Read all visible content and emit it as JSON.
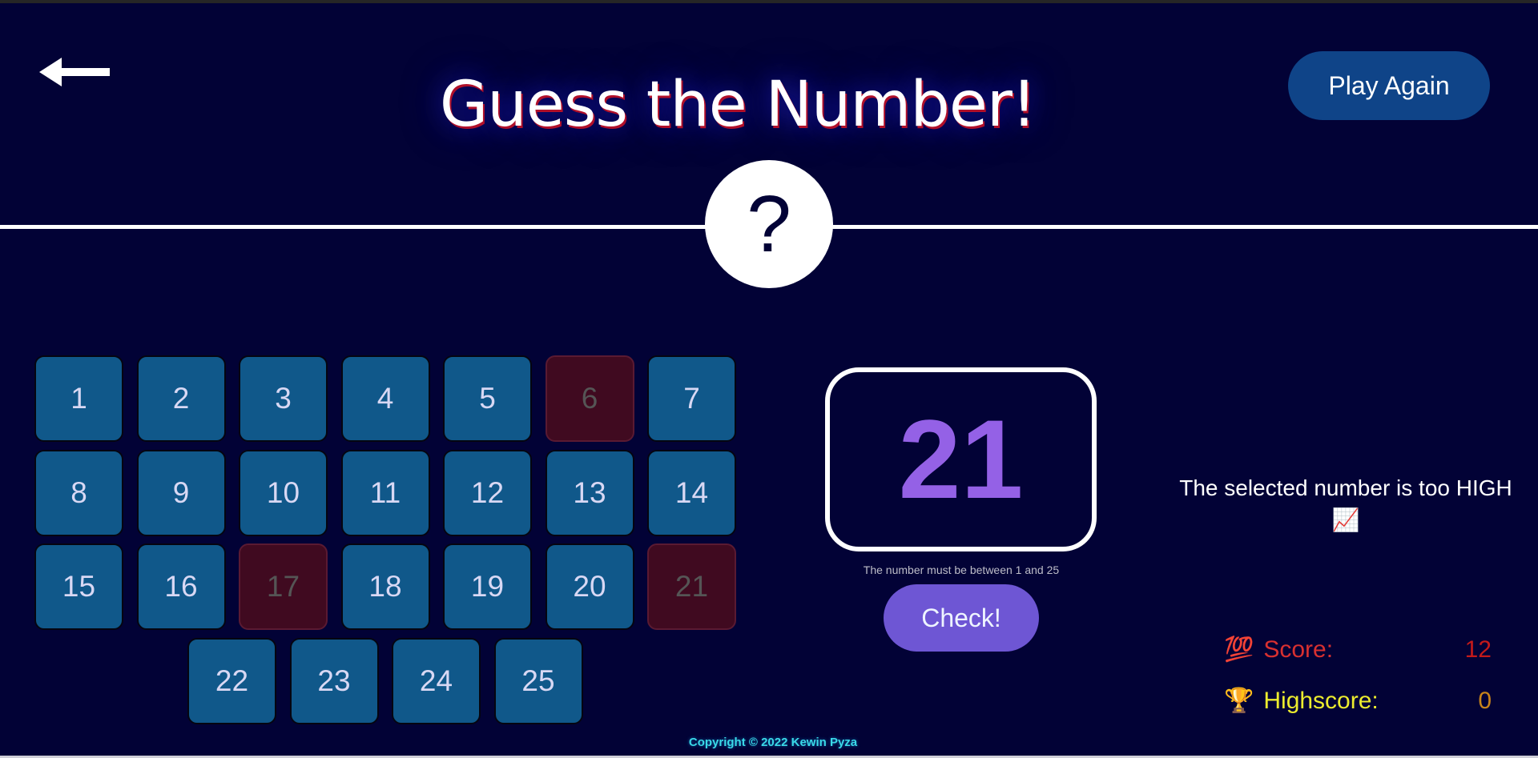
{
  "header": {
    "title": "Guess the Number!",
    "play_again_label": "Play Again",
    "mystery_symbol": "?"
  },
  "board": {
    "tiles": [
      {
        "n": "1",
        "state": "available"
      },
      {
        "n": "2",
        "state": "available"
      },
      {
        "n": "3",
        "state": "available"
      },
      {
        "n": "4",
        "state": "available"
      },
      {
        "n": "5",
        "state": "available"
      },
      {
        "n": "6",
        "state": "wrong"
      },
      {
        "n": "7",
        "state": "available"
      },
      {
        "n": "8",
        "state": "available"
      },
      {
        "n": "9",
        "state": "available"
      },
      {
        "n": "10",
        "state": "available"
      },
      {
        "n": "11",
        "state": "available"
      },
      {
        "n": "12",
        "state": "available"
      },
      {
        "n": "13",
        "state": "available"
      },
      {
        "n": "14",
        "state": "available"
      },
      {
        "n": "15",
        "state": "available"
      },
      {
        "n": "16",
        "state": "available"
      },
      {
        "n": "17",
        "state": "wrong"
      },
      {
        "n": "18",
        "state": "available"
      },
      {
        "n": "19",
        "state": "available"
      },
      {
        "n": "20",
        "state": "available"
      },
      {
        "n": "21",
        "state": "wrong"
      },
      {
        "n": "22",
        "state": "available"
      },
      {
        "n": "23",
        "state": "available"
      },
      {
        "n": "24",
        "state": "available"
      },
      {
        "n": "25",
        "state": "available"
      }
    ]
  },
  "guess": {
    "selected": "21",
    "hint": "The number must be between 1 and 25",
    "check_label": "Check!"
  },
  "feedback": {
    "message": "The selected number is too HIGH",
    "emoji": "📈"
  },
  "stats": {
    "score_emoji": "💯",
    "score_label": "Score:",
    "score_value": "12",
    "highscore_emoji": "🏆",
    "highscore_label": "Highscore:",
    "highscore_value": "0"
  },
  "footer": {
    "copyright": "Copyright © 2022 Kewin Pyza"
  },
  "colors": {
    "background": "#020236",
    "tile": "#10588a",
    "tile_wrong": "#400a20",
    "accent": "#6e56d4",
    "selected_number": "#9461e6"
  }
}
